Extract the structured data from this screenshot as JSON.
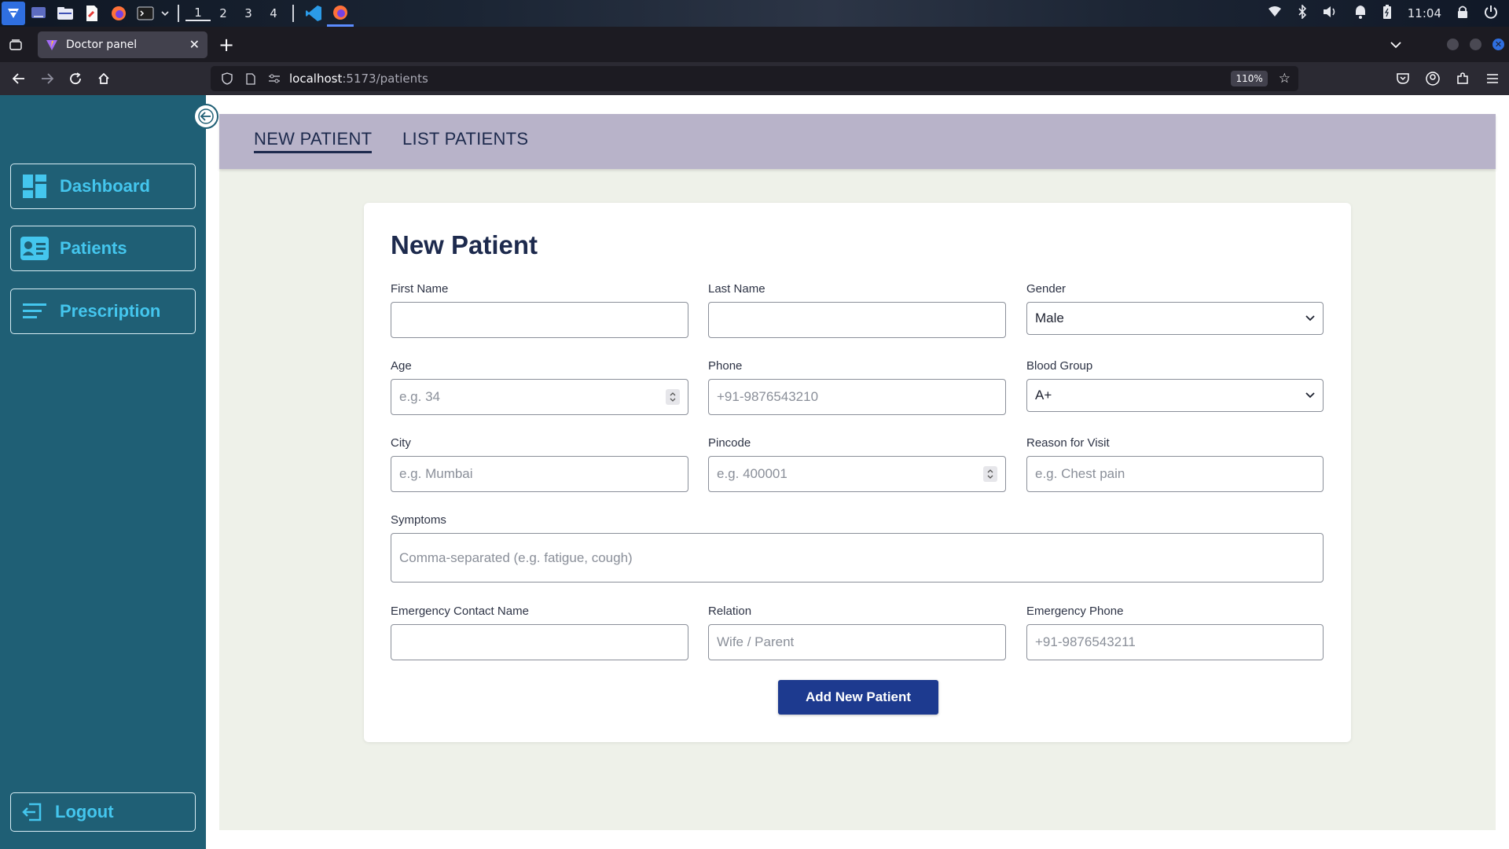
{
  "taskbar": {
    "workspaces": [
      "1",
      "2",
      "3",
      "4"
    ],
    "time": "11:04"
  },
  "browser": {
    "tab_title": "Doctor panel",
    "url_host": "localhost",
    "url_path": ":5173/patients",
    "zoom": "110%"
  },
  "sidebar": {
    "items": [
      {
        "label": "Dashboard",
        "icon": "dashboard-icon"
      },
      {
        "label": "Patients",
        "icon": "id-card-icon"
      },
      {
        "label": "Prescription",
        "icon": "list-icon"
      }
    ],
    "logout_label": "Logout"
  },
  "topnav": {
    "new_patient": "NEW PATIENT",
    "list_patients": "LIST PATIENTS"
  },
  "form": {
    "title": "New Patient",
    "first_name": {
      "label": "First Name",
      "value": ""
    },
    "last_name": {
      "label": "Last Name",
      "value": ""
    },
    "gender": {
      "label": "Gender",
      "value": "Male"
    },
    "age": {
      "label": "Age",
      "placeholder": "e.g. 34"
    },
    "phone": {
      "label": "Phone",
      "placeholder": "+91-9876543210"
    },
    "blood_group": {
      "label": "Blood Group",
      "value": "A+"
    },
    "city": {
      "label": "City",
      "placeholder": "e.g. Mumbai"
    },
    "pincode": {
      "label": "Pincode",
      "placeholder": "e.g. 400001"
    },
    "reason": {
      "label": "Reason for Visit",
      "placeholder": "e.g. Chest pain"
    },
    "symptoms": {
      "label": "Symptoms",
      "placeholder": "Comma-separated (e.g. fatigue, cough)"
    },
    "emergency_name": {
      "label": "Emergency Contact Name",
      "value": ""
    },
    "relation": {
      "label": "Relation",
      "placeholder": "Wife / Parent"
    },
    "emergency_phone": {
      "label": "Emergency Phone",
      "placeholder": "+91-9876543211"
    },
    "submit_label": "Add New Patient"
  },
  "colors": {
    "sidebar_bg": "#1f5f75",
    "sidebar_accent": "#44c6ee",
    "topnav_bg": "#b8b3c9",
    "content_bg": "#eef1e9",
    "primary_button": "#1d3a8f",
    "heading": "#1d2a4d"
  }
}
